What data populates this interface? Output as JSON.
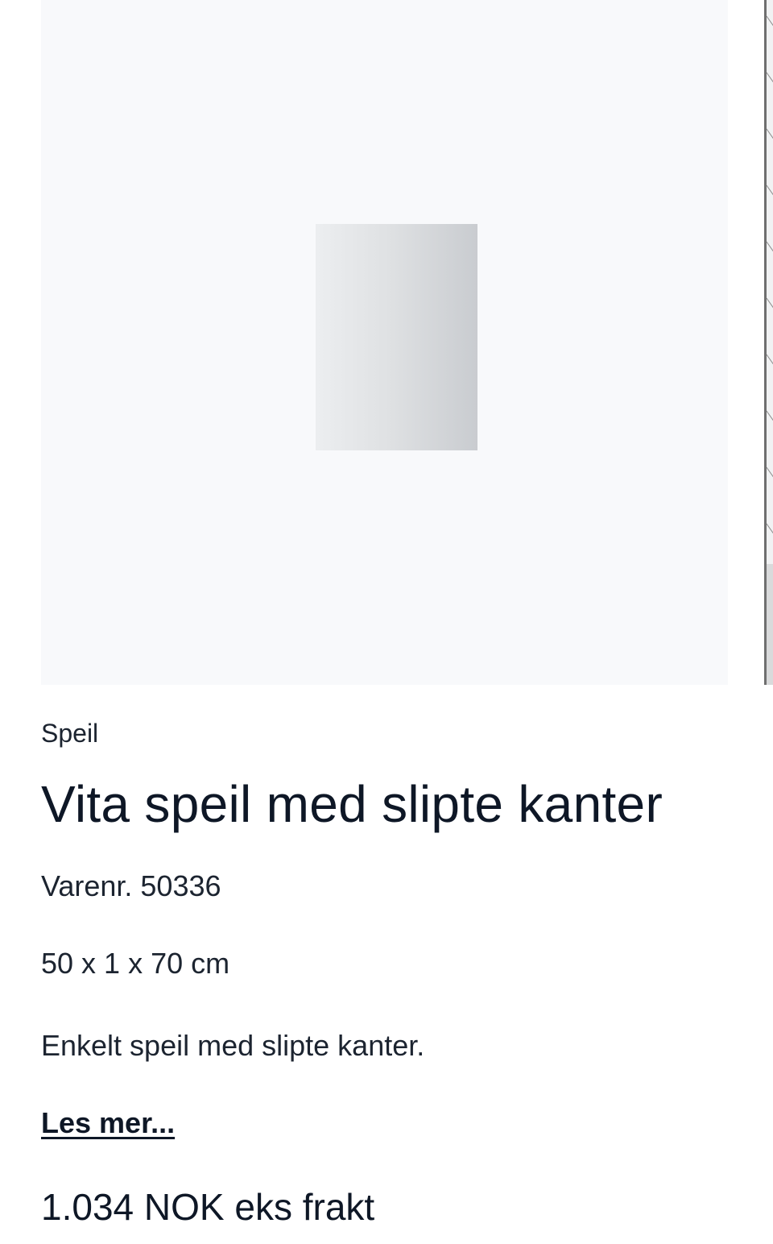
{
  "product": {
    "category": "Speil",
    "title": "Vita speil med slipte kanter",
    "sku": "Varenr. 50336",
    "dimensions": "50 x 1 x 70 cm",
    "description": "Enkelt speil med slipte kanter.",
    "read_more_label": "Les mer...",
    "price": "1.034 NOK eks frakt"
  },
  "gallery": {
    "images": [
      "mirror-product-image",
      "bathroom-scene-image"
    ],
    "background_color": "#f8f9fb"
  },
  "colors": {
    "text_primary": "#0e1726",
    "text_secondary": "#1c2430"
  }
}
